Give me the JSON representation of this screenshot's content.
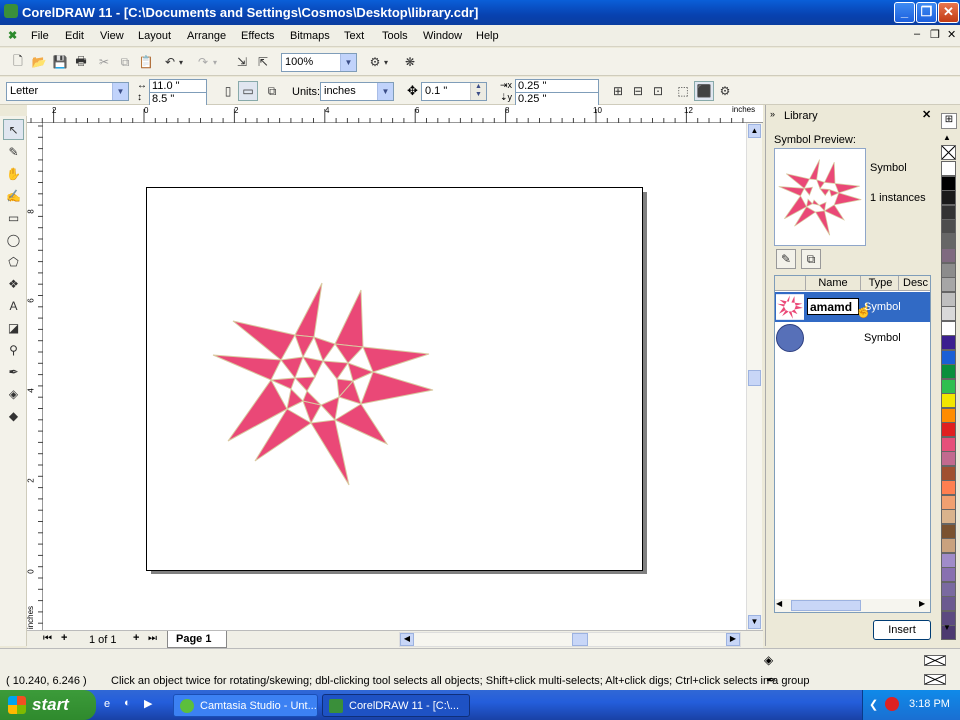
{
  "window": {
    "title": "CorelDRAW 11 - [C:\\Documents and Settings\\Cosmos\\Desktop\\library.cdr]"
  },
  "menu": [
    "File",
    "Edit",
    "View",
    "Layout",
    "Arrange",
    "Effects",
    "Bitmaps",
    "Text",
    "Tools",
    "Window",
    "Help"
  ],
  "standard_toolbar": {
    "zoom": "100%"
  },
  "property_bar": {
    "paper": "Letter",
    "width": "11.0 \"",
    "height": "8.5 \"",
    "units_label": "Units:",
    "units": "inches",
    "nudge": "0.1 \"",
    "dup_x": "0.25 \"",
    "dup_y": "0.25 \""
  },
  "ruler": {
    "top_ticks": [
      "2",
      "0",
      "2",
      "4",
      "6",
      "8",
      "10",
      "12"
    ],
    "top_unit": "inches",
    "left_ticks": [
      "8",
      "6",
      "4",
      "2",
      "0"
    ],
    "left_unit": "inches"
  },
  "page_nav": {
    "counter": "1 of 1",
    "tab": "Page 1"
  },
  "docker": {
    "title": "Library",
    "preview_label": "Symbol Preview:",
    "preview_type": "Symbol",
    "preview_instances": "1 instances",
    "columns": [
      "Name",
      "Type",
      "Desc"
    ],
    "rows": [
      {
        "name": "amamd",
        "type": "Symbol",
        "selected": true
      },
      {
        "name": "",
        "type": "Symbol",
        "selected": false
      }
    ],
    "insert_button": "Insert"
  },
  "palette": [
    "#ffffff",
    "#000000",
    "#1a1a1a",
    "#333333",
    "#4d4d4d",
    "#666666",
    "#7f6a80",
    "#8c8c8c",
    "#a6a6a6",
    "#bfbfbf",
    "#d9d9d9",
    "#ffffff",
    "#3b1f8f",
    "#1a5fd6",
    "#0a8f3c",
    "#2fbf4f",
    "#f2e600",
    "#ff8c00",
    "#e02020",
    "#e6507a",
    "#c26a8f",
    "#a05030",
    "#ff7f50",
    "#f0a070",
    "#d9b38c",
    "#7a5230",
    "#c9a27e",
    "#a08cc9",
    "#8870b0",
    "#7a6aa0",
    "#6b5a90",
    "#5c4a80",
    "#4d3a70"
  ],
  "status": {
    "coords": "( 10.240, 6.246 )",
    "hint": "Click an object twice for rotating/skewing; dbl-clicking tool selects all objects; Shift+click multi-selects; Alt+click digs; Ctrl+click selects in a group"
  },
  "taskbar": {
    "start": "start",
    "tasks": [
      "Camtasia Studio - Unt...",
      "CorelDRAW 11 - [C:\\..."
    ],
    "time": "3:18 PM"
  }
}
